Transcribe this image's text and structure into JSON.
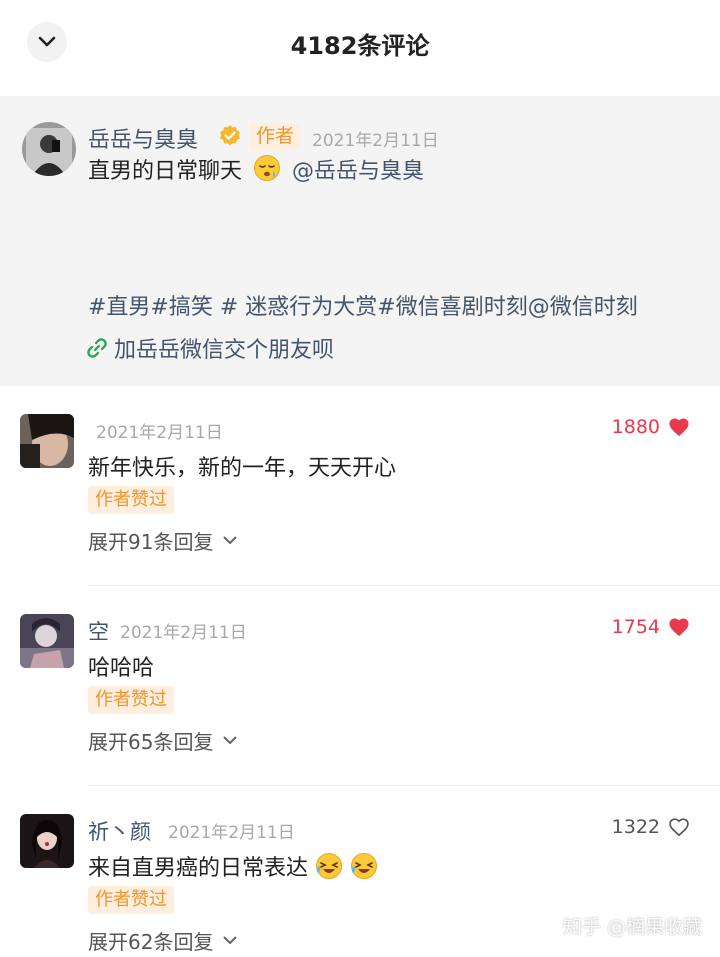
{
  "header": {
    "title": "4182条评论",
    "back_icon": "chevron-down-icon"
  },
  "post": {
    "author": "岳岳与臭臭",
    "author_tag": "作者",
    "date": "2021年2月11日",
    "text": "直男的日常聊天",
    "mention": "@岳岳与臭臭",
    "hashtags": "#直男#搞笑 # 迷惑行为大赏#微信喜剧时刻@微信时刻",
    "link_text": "加岳岳微信交个朋友呗",
    "accent": "#44556b"
  },
  "comments": [
    {
      "name": "",
      "date": "2021年2月11日",
      "likes": "1880",
      "liked": true,
      "text": "新年快乐，新的一年，天天开心",
      "badge": "作者赞过",
      "expand": "展开91条回复"
    },
    {
      "name": "空",
      "date": "2021年2月11日",
      "likes": "1754",
      "liked": true,
      "text": "哈哈哈",
      "badge": "作者赞过",
      "expand": "展开65条回复"
    },
    {
      "name": "祈丶颜",
      "date": "2021年2月11日",
      "likes": "1322",
      "liked": false,
      "text": "来自直男癌的日常表达",
      "badge": "作者赞过",
      "expand": "展开62条回复"
    }
  ],
  "watermark": "知乎 @楠果收藏",
  "colors": {
    "like_red": "#e8394d",
    "badge_orange": "#f0952f",
    "badge_bg": "#fdeedd"
  }
}
